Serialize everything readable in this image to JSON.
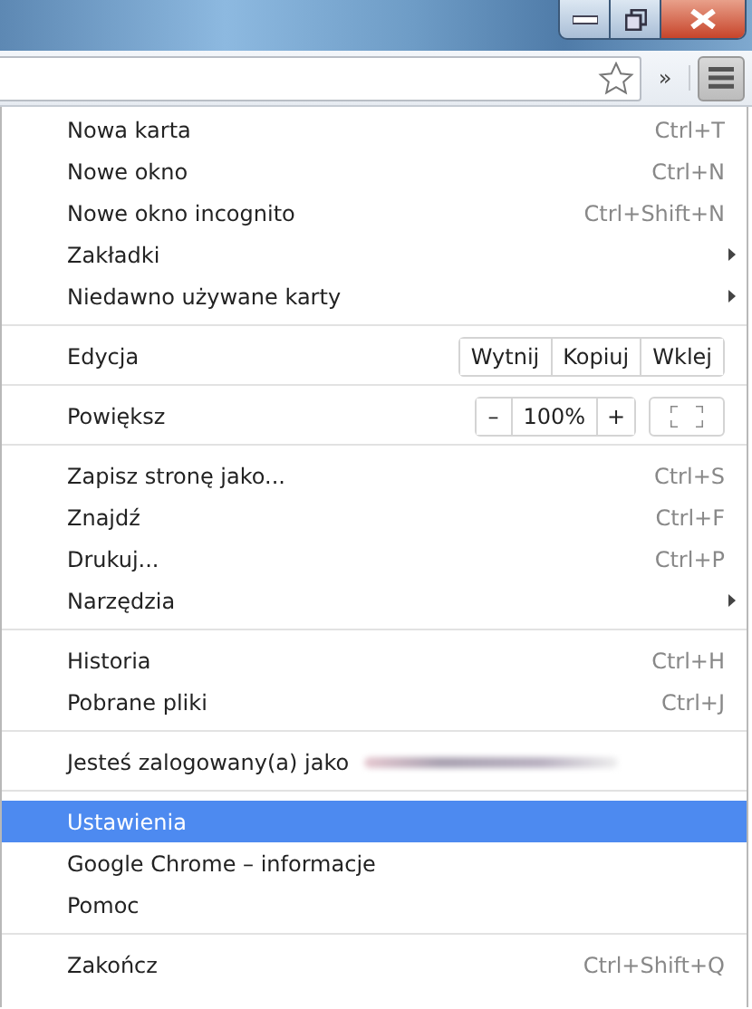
{
  "menu": {
    "sections": [
      [
        {
          "kind": "item",
          "label": "Nowa karta",
          "shortcut": "Ctrl+T",
          "submenu": false,
          "selected": false
        },
        {
          "kind": "item",
          "label": "Nowe okno",
          "shortcut": "Ctrl+N",
          "submenu": false,
          "selected": false
        },
        {
          "kind": "item",
          "label": "Nowe okno incognito",
          "shortcut": "Ctrl+Shift+N",
          "submenu": false,
          "selected": false
        },
        {
          "kind": "item",
          "label": "Zakładki",
          "submenu": true,
          "selected": false
        },
        {
          "kind": "item",
          "label": "Niedawno używane karty",
          "submenu": true,
          "selected": false
        }
      ],
      [
        {
          "kind": "edit",
          "label": "Edycja",
          "buttons": [
            "Wytnij",
            "Kopiuj",
            "Wklej"
          ]
        }
      ],
      [
        {
          "kind": "zoom",
          "label": "Powiększ",
          "minus": "–",
          "value": "100%",
          "plus": "+"
        }
      ],
      [
        {
          "kind": "item",
          "label": "Zapisz stronę jako...",
          "shortcut": "Ctrl+S",
          "submenu": false,
          "selected": false
        },
        {
          "kind": "item",
          "label": "Znajdź",
          "shortcut": "Ctrl+F",
          "submenu": false,
          "selected": false
        },
        {
          "kind": "item",
          "label": "Drukuj...",
          "shortcut": "Ctrl+P",
          "submenu": false,
          "selected": false
        },
        {
          "kind": "item",
          "label": "Narzędzia",
          "submenu": true,
          "selected": false
        }
      ],
      [
        {
          "kind": "item",
          "label": "Historia",
          "shortcut": "Ctrl+H",
          "submenu": false,
          "selected": false
        },
        {
          "kind": "item",
          "label": "Pobrane pliki",
          "shortcut": "Ctrl+J",
          "submenu": false,
          "selected": false
        }
      ],
      [
        {
          "kind": "account",
          "label": "Jesteś zalogowany(a) jako"
        }
      ],
      [
        {
          "kind": "item",
          "label": "Ustawienia",
          "submenu": false,
          "selected": true
        },
        {
          "kind": "item",
          "label": "Google Chrome – informacje",
          "submenu": false,
          "selected": false
        },
        {
          "kind": "item",
          "label": "Pomoc",
          "submenu": false,
          "selected": false
        }
      ],
      [
        {
          "kind": "item",
          "label": "Zakończ",
          "shortcut": "Ctrl+Shift+Q",
          "submenu": false,
          "selected": false
        }
      ]
    ],
    "overflow": "»"
  }
}
